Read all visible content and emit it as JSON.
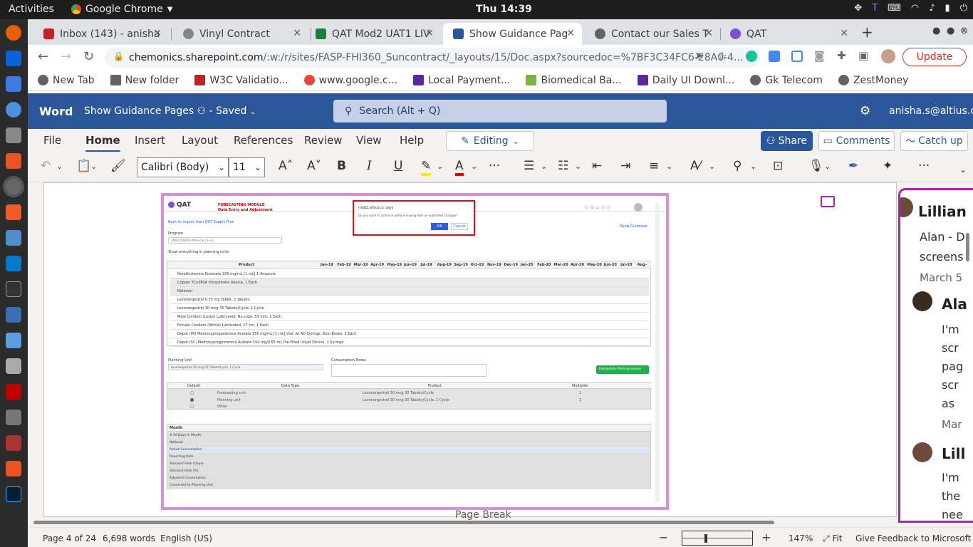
{
  "system": {
    "activities": "Activities",
    "app_name": "Google Chrome",
    "clock": "Thu 14:39"
  },
  "tabs": [
    {
      "label": "Inbox (143) - anisha",
      "color": "#c5221f"
    },
    {
      "label": "Vinyl Contract",
      "color": "#5f6368"
    },
    {
      "label": "QAT Mod2 UAT1 LIV",
      "color": "#188038"
    },
    {
      "label": "Show Guidance Pag",
      "color": "#2b579a"
    },
    {
      "label": "Contact our Sales T",
      "color": "#5f6368"
    },
    {
      "label": "QAT",
      "color": "#7b4fd6"
    }
  ],
  "address": {
    "host": "chemonics.sharepoint.com",
    "path": "/:w:/r/sites/FASP-FHI360_Suncontract/_layouts/15/Doc.aspx?sourcedoc=%7BF3C34FC6-28A0-4...",
    "update_label": "Update"
  },
  "bookmarks": [
    {
      "label": "New Tab",
      "color": "#5f6368"
    },
    {
      "label": "New folder",
      "color": "#5f6368"
    },
    {
      "label": "W3C Validatio...",
      "color": "#c5221f"
    },
    {
      "label": "www.google.c...",
      "color": "#ea4335"
    },
    {
      "label": "Local Payment...",
      "color": "#5f259f"
    },
    {
      "label": "Biomedical Ba...",
      "color": "#7cb342"
    },
    {
      "label": "Daily UI Downl...",
      "color": "#5f259f"
    },
    {
      "label": "Gk Telecom",
      "color": "#5f6368"
    },
    {
      "label": "ZestMoney",
      "color": "#5f6368"
    }
  ],
  "word": {
    "brand": "Word",
    "doc_title": "Show Guidance Pages",
    "saved": "- Saved",
    "search_placeholder": "Search (Alt + Q)",
    "account": "anisha.s@altius.cc",
    "ribbon_tabs": [
      "File",
      "Home",
      "Insert",
      "Layout",
      "References",
      "Review",
      "View",
      "Help"
    ],
    "editing_label": "Editing",
    "share_label": "Share",
    "comments_label": "Comments",
    "catchup_label": "Catch up",
    "font_name": "Calibri (Body)",
    "font_size": "11"
  },
  "embedded": {
    "logo": "QAT",
    "module": "FORECASTING MODULE",
    "subtitle": "Data Entry and Adjustment",
    "dialog_host": "mod2.altius.cc says",
    "dialog_msg": "Do you want to continue without leaving with un-submitted changes?",
    "ok": "OK",
    "cancel": "Cancel",
    "back_link": "Back to Import from QAT Supply Plan",
    "show_guidance": "Show Guidance",
    "program_label": "Program",
    "program_value": "ZMB-CONTRA-MOH-scen 1~v1",
    "show_planning": "Show everything in planning units",
    "months": [
      "Jan-19",
      "Feb-19",
      "Mar-19",
      "Apr-19",
      "May-19",
      "Jun-19",
      "Jul-19",
      "Aug-19",
      "Sep-19",
      "Oct-19",
      "Nov-19",
      "Dec-19",
      "Jan-20",
      "Feb-20",
      "Mar-20",
      "Apr-20",
      "May-20",
      "Jun-20",
      "Jul-20",
      "Aug-"
    ],
    "product_header": "Product",
    "products": [
      "Norethisterone Enantate 200 mg/mL [1 mL] 1 Ampoule",
      "Copper TCu380A Intrauterine Device, 1 Each",
      "National",
      "Levonorgestrel 0.75 mg Tablet, 2 Tablets",
      "Levonorgestrel 30 mcg 35 Tablets/Cycle, 1 Cycle",
      "Male Condom (Latex) Lubricated, No Logo, 53 mm, 1 Each",
      "Female Condom (Nitrile) Lubricated, 17 cm, 1 Each",
      "Depot (IM) Medroxyprogesterone Acetate 150 mg/mL [1 mL] Vial, w/ AD Syringe, Buin Boxes, 1 Each",
      "Depot (SC) Medroxyprogesterone Acetate 104 mg/0.65 mL Pre-Filled Unijet Device, 1 Syringe"
    ],
    "planning_unit_label": "Planning Unit",
    "planning_unit_value": "Levonorgestrel 30 mcg 35 Tablets/Cycle, 1 Cycle",
    "consumption_notes": "Consumption Notes",
    "interpolate": "Interpolate Missing values",
    "sub_headers": [
      "Default",
      "Data Type",
      "Product",
      "Multiplier"
    ],
    "sub_rows": [
      [
        "Forecasting unit",
        "Levonorgestrel 30 mcg 35 Tablets/Cycle",
        "1"
      ],
      [
        "Planning unit",
        "Levonorgestrel 30 mcg 35 Tablets/Cycle, 1 Cycle",
        "1"
      ],
      [
        "Other",
        "",
        ""
      ]
    ],
    "month_header": "Month",
    "bottom_rows": [
      "# Of Days in Month",
      "National",
      "Actual Consumption",
      "Reporting Rate",
      "Stockout Rate (Days)",
      "Stockout Rate (%)",
      "Adjusted Consumption",
      "Converted to Planning Unit"
    ]
  },
  "comments": {
    "c1_name": "Lillian",
    "c1_text1": "Alan - D",
    "c1_text2": "screens",
    "c1_date": "March 5",
    "c2_name": "Ala",
    "c2_lines": [
      "I'm",
      "scr",
      "pag",
      "scr",
      "as"
    ],
    "c2_date": "Mar",
    "c3_name": "Lill",
    "c3_lines": [
      "I'm",
      "the",
      "nee"
    ]
  },
  "page_break": "Page Break",
  "status": {
    "page": "Page 4 of 24",
    "words": "6,698 words",
    "lang": "English (US)",
    "zoom": "147%",
    "fit": "Fit",
    "feedback": "Give Feedback to Microsoft"
  }
}
